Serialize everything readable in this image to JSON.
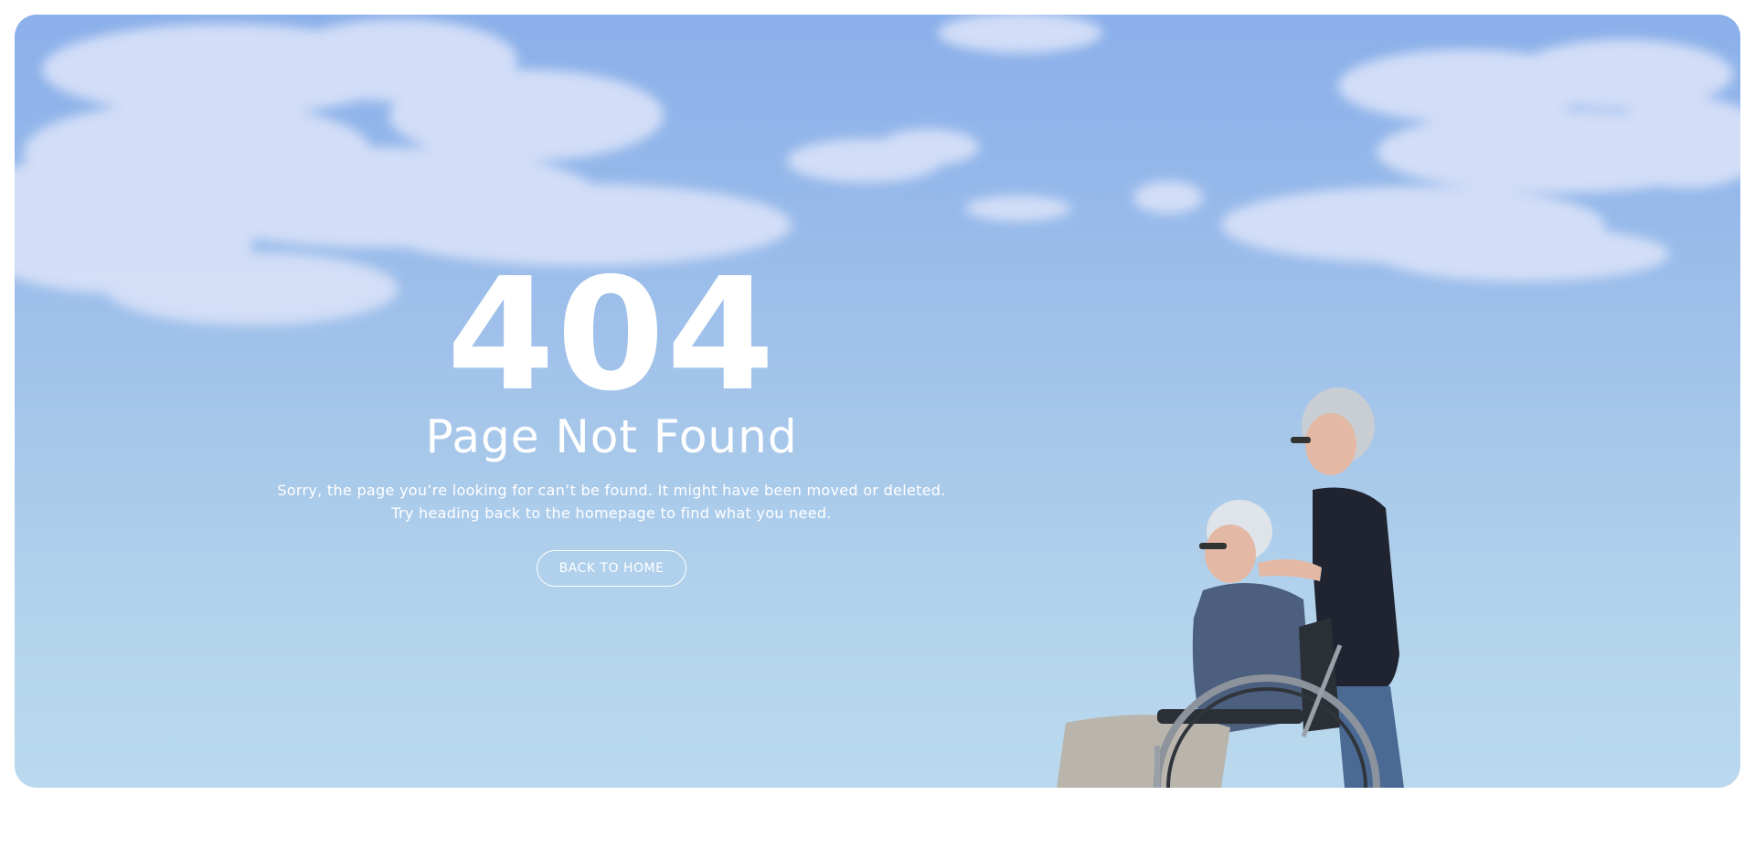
{
  "error": {
    "code": "404",
    "title": "Page Not Found",
    "message_line1": "Sorry, the page you’re looking for can’t be found. It might have been moved or deleted.",
    "message_line2": "Try heading back to the homepage to find what you need."
  },
  "actions": {
    "back_home_label": "BACK TO HOME"
  },
  "colors": {
    "sky_top": "#8bb0ea",
    "sky_bottom": "#bad9ee",
    "text": "#ffffff"
  }
}
